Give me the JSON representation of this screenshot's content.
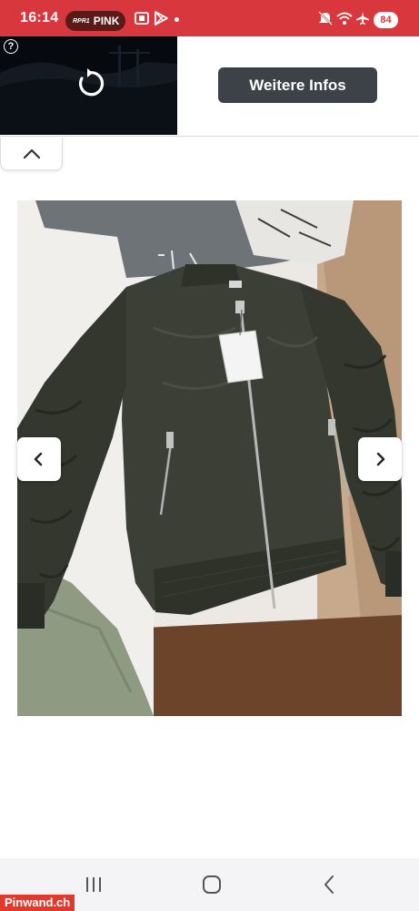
{
  "status_bar": {
    "time": "16:14",
    "carrier_brand": "RPR1",
    "carrier_name": "PINK",
    "battery": "84",
    "icons": [
      "screenshot-icon",
      "play-store-icon",
      "notification-dot",
      "mute-icon",
      "wifi-icon",
      "airplane-icon",
      "battery-icon"
    ],
    "background_color": "#d9373e"
  },
  "ad": {
    "help_label": "?",
    "button_label": "Weitere Infos",
    "icons": [
      "help-icon",
      "replay-icon"
    ],
    "button_color": "#3d4148"
  },
  "collapse_tab": {
    "icon": "chevron-up-icon"
  },
  "gallery": {
    "image_subject": "olive bomber jacket",
    "prev_icon": "chevron-left-icon",
    "next_icon": "chevron-right-icon"
  },
  "system_nav": {
    "icons": [
      "recent-apps-icon",
      "home-icon",
      "back-icon"
    ]
  },
  "watermark": {
    "text": "Pinwand.ch"
  }
}
